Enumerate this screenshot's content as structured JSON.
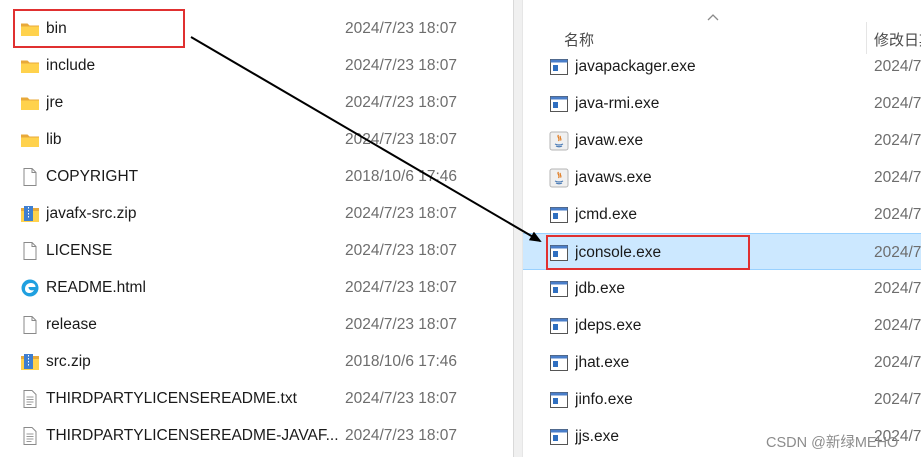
{
  "left_pane": {
    "files": [
      {
        "name": "bin",
        "date": "2024/7/23 18:07",
        "icon": "folder-icon"
      },
      {
        "name": "include",
        "date": "2024/7/23 18:07",
        "icon": "folder-icon"
      },
      {
        "name": "jre",
        "date": "2024/7/23 18:07",
        "icon": "folder-icon"
      },
      {
        "name": "lib",
        "date": "2024/7/23 18:07",
        "icon": "folder-icon"
      },
      {
        "name": "COPYRIGHT",
        "date": "2018/10/6 17:46",
        "icon": "document-icon"
      },
      {
        "name": "javafx-src.zip",
        "date": "2024/7/23 18:07",
        "icon": "zip-archive-icon"
      },
      {
        "name": "LICENSE",
        "date": "2024/7/23 18:07",
        "icon": "document-icon"
      },
      {
        "name": "README.html",
        "date": "2024/7/23 18:07",
        "icon": "edge-browser-icon"
      },
      {
        "name": "release",
        "date": "2024/7/23 18:07",
        "icon": "document-icon"
      },
      {
        "name": "src.zip",
        "date": "2018/10/6 17:46",
        "icon": "zip-archive-icon"
      },
      {
        "name": "THIRDPARTYLICENSEREADME.txt",
        "date": "2024/7/23 18:07",
        "icon": "text-file-icon"
      },
      {
        "name": "THIRDPARTYLICENSEREADME-JAVAF...",
        "date": "2024/7/23 18:07",
        "icon": "text-file-icon"
      }
    ]
  },
  "right_pane": {
    "header": {
      "name_label": "名称",
      "date_label": "修改日期"
    },
    "files": [
      {
        "name": "javapackager.exe",
        "date": "2024/7",
        "icon": "exe-icon"
      },
      {
        "name": "java-rmi.exe",
        "date": "2024/7",
        "icon": "exe-icon"
      },
      {
        "name": "javaw.exe",
        "date": "2024/7",
        "icon": "java-icon"
      },
      {
        "name": "javaws.exe",
        "date": "2024/7",
        "icon": "java-icon"
      },
      {
        "name": "jcmd.exe",
        "date": "2024/7",
        "icon": "exe-icon"
      },
      {
        "name": "jconsole.exe",
        "date": "2024/7",
        "icon": "exe-icon",
        "selected": true
      },
      {
        "name": "jdb.exe",
        "date": "2024/7",
        "icon": "exe-icon"
      },
      {
        "name": "jdeps.exe",
        "date": "2024/7",
        "icon": "exe-icon"
      },
      {
        "name": "jhat.exe",
        "date": "2024/7",
        "icon": "exe-icon"
      },
      {
        "name": "jinfo.exe",
        "date": "2024/7",
        "icon": "exe-icon"
      },
      {
        "name": "jjs.exe",
        "date": "2024/7",
        "icon": "exe-icon"
      }
    ]
  },
  "annotation_colors": {
    "highlight": "#e03030",
    "selection": "#cce8ff"
  },
  "watermark": "CSDN @新绿MEHO"
}
